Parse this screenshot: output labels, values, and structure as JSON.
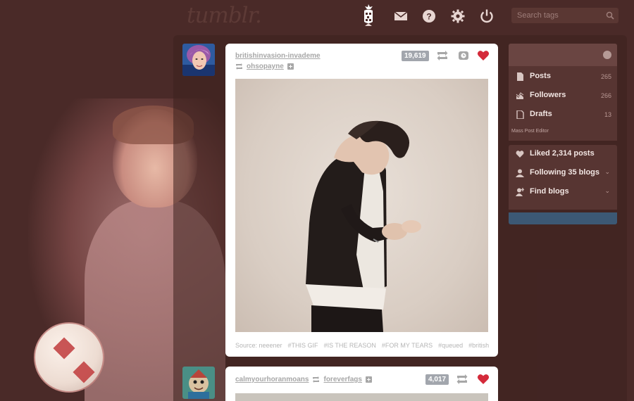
{
  "header": {
    "logo": "tumblr.",
    "search_placeholder": "Search tags"
  },
  "posts": [
    {
      "username": "britishinvasion-invademe",
      "reblogged_from": "ohsopayne",
      "notes": "19,619",
      "tags": [
        "Source: neeener",
        "#THIS GIF",
        "#IS THE REASON",
        "#FOR MY TEARS",
        "#queued",
        "#british"
      ]
    },
    {
      "username": "calmyourhoranmoans",
      "reblogged_from": "foreverfags",
      "notes": "4,017"
    }
  ],
  "sidebar": {
    "items": [
      {
        "label": "Posts",
        "count": "265"
      },
      {
        "label": "Followers",
        "count": "266"
      },
      {
        "label": "Drafts",
        "count": "13"
      }
    ],
    "mass_edit": "Mass Post Editor",
    "items2": [
      {
        "label": "Liked 2,314 posts"
      },
      {
        "label": "Following 35 blogs"
      },
      {
        "label": "Find blogs"
      }
    ]
  },
  "colors": {
    "background": "#4a2a28",
    "heart": "#d42a3a",
    "notes_badge": "#a2a6ad"
  }
}
